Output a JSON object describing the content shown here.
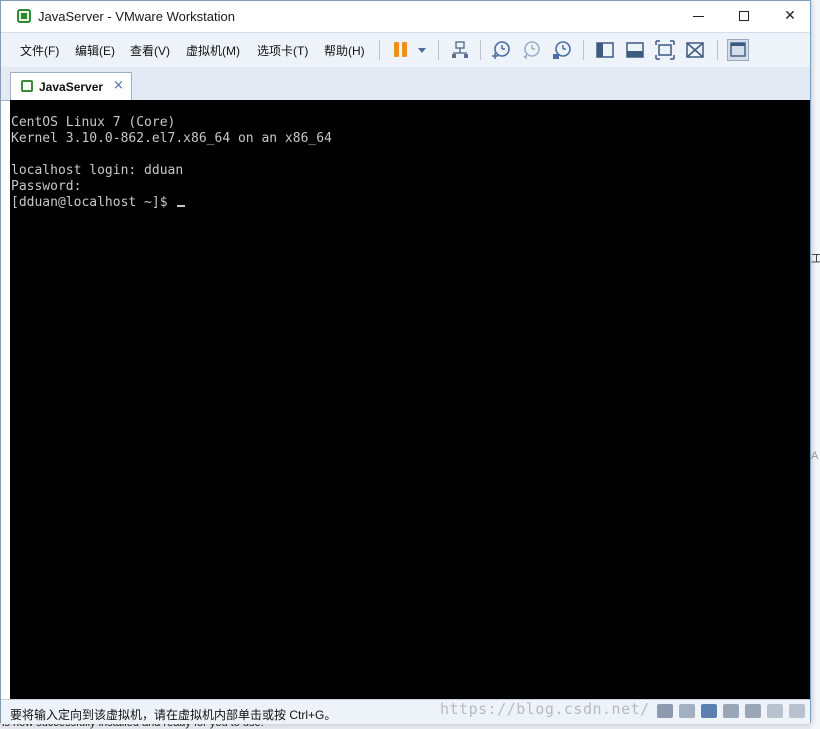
{
  "window": {
    "title": "JavaServer - VMware Workstation",
    "buttons": {
      "minimize": "—",
      "maximize": "☐",
      "close": "✕"
    }
  },
  "menu": {
    "items": [
      {
        "label": "文件(F)"
      },
      {
        "label": "编辑(E)"
      },
      {
        "label": "查看(V)"
      },
      {
        "label": "虚拟机(M)"
      },
      {
        "label": "选项卡(T)"
      },
      {
        "label": "帮助(H)"
      }
    ],
    "accent_pause_color": "#f0901c"
  },
  "toolbar": {
    "icons": [
      "pause-icon",
      "dropdown-icon",
      "network-icon",
      "snapshot-take-icon",
      "snapshot-revert-icon",
      "snapshot-manager-icon",
      "library-view-icon",
      "thumbnail-view-icon",
      "fullscreen-icon",
      "unity-icon",
      "console-view-icon"
    ]
  },
  "tabs": [
    {
      "label": "JavaServer",
      "close": "×"
    }
  ],
  "console": {
    "lines": [
      "CentOS Linux 7 (Core)",
      "Kernel 3.10.0-862.el7.x86_64 on an x86_64",
      "",
      "localhost login: dduan",
      "Password:",
      "[dduan@localhost ~]$ "
    ],
    "background": "#000000",
    "foreground": "#c8c8c8"
  },
  "status": {
    "message": "要将输入定向到该虚拟机，请在虚拟机内部单击或按 Ctrl+G。",
    "watermark": "https://blog.csdn.net/"
  },
  "background_app": {
    "bottom_text": "is now successfully installed and ready for you to use!"
  }
}
